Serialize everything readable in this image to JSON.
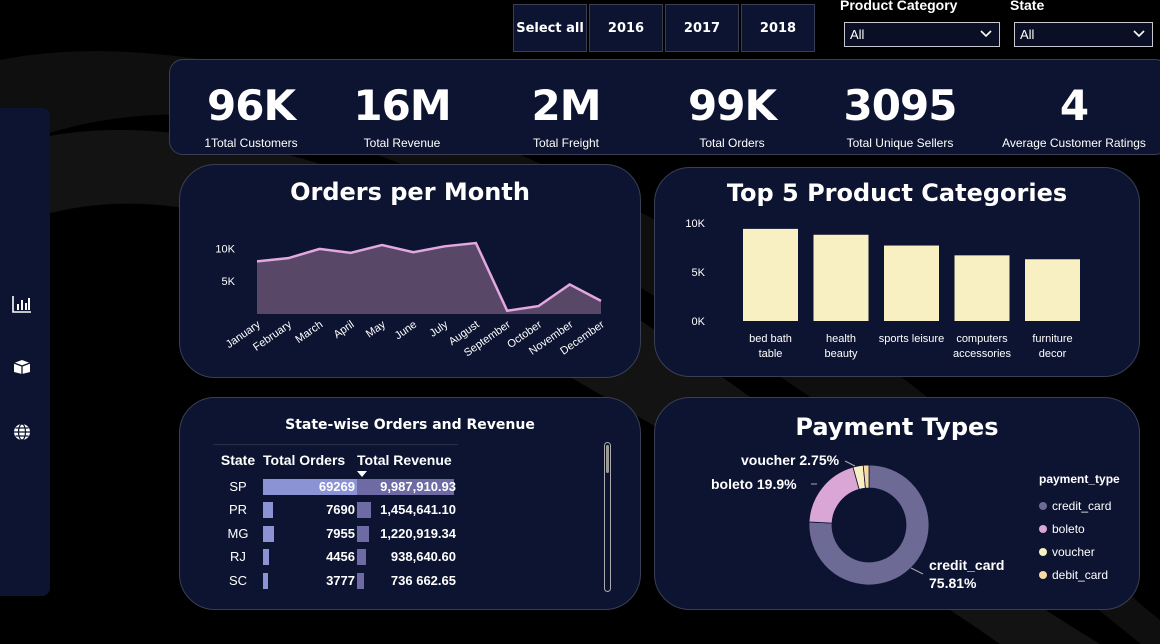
{
  "colors": {
    "background": "#000000",
    "panel": "#0d1431",
    "area_fill": "#594768",
    "area_line": "#e3a8e0",
    "bar_yellow": "#f8efc2",
    "table_bar_orders": "#8b93d4",
    "table_bar_revenue": "#6e6aa3",
    "donut_credit": "#6e6a96",
    "donut_boleto": "#d9a6d6",
    "donut_voucher": "#f8efc2",
    "donut_debit": "#f9d8a8"
  },
  "sidebar": {
    "icons": [
      "bar-chart-icon",
      "box-icon",
      "globe-icon"
    ]
  },
  "year_slicer": {
    "options": [
      "Select all",
      "2016",
      "2017",
      "2018"
    ]
  },
  "filters": {
    "category": {
      "label": "Product Category",
      "value": "All"
    },
    "state": {
      "label": "State",
      "value": "All"
    }
  },
  "kpis": [
    {
      "value": "96K",
      "label": "1Total Customers"
    },
    {
      "value": "16M",
      "label": "Total Revenue"
    },
    {
      "value": "2M",
      "label": "Total Freight"
    },
    {
      "value": "99K",
      "label": "Total Orders"
    },
    {
      "value": "3095",
      "label": "Total Unique Sellers"
    },
    {
      "value": "4",
      "label": "Average Customer Ratings"
    }
  ],
  "chart_data": [
    {
      "id": "orders_per_month",
      "type": "area",
      "title": "Orders per Month",
      "categories": [
        "January",
        "February",
        "March",
        "April",
        "May",
        "June",
        "July",
        "August",
        "September",
        "October",
        "November",
        "December"
      ],
      "values": [
        8000,
        8500,
        9900,
        9300,
        10500,
        9400,
        10300,
        10800,
        500,
        1200,
        4500,
        2000
      ],
      "ylim": [
        0,
        14000
      ],
      "yticks": [
        5000,
        10000
      ],
      "ytick_labels": [
        "5K",
        "10K"
      ],
      "grid": false
    },
    {
      "id": "top5_categories",
      "type": "bar",
      "title": "Top 5 Product Categories",
      "categories": [
        [
          "bed bath",
          "table"
        ],
        [
          "health",
          "beauty"
        ],
        [
          "sports leisure"
        ],
        [
          "computers",
          "accessories"
        ],
        [
          "furniture",
          "decor"
        ]
      ],
      "values": [
        9400,
        8800,
        7700,
        6700,
        6300
      ],
      "ylim": [
        0,
        10000
      ],
      "yticks": [
        0,
        5000,
        10000
      ],
      "ytick_labels": [
        "0K",
        "5K",
        "10K"
      ],
      "grid": false
    },
    {
      "id": "payment_types",
      "type": "pie",
      "title": "Payment Types",
      "legend_title": "payment_type",
      "legend_position": "right",
      "slices": [
        {
          "name": "credit_card",
          "value": 75.81
        },
        {
          "name": "boleto",
          "value": 19.9
        },
        {
          "name": "voucher",
          "value": 2.75
        },
        {
          "name": "debit_card",
          "value": 1.54
        }
      ],
      "labels": {
        "credit_card": [
          "credit_card",
          "75.81%"
        ],
        "boleto": "boleto 19.9%",
        "voucher": "voucher 2.75%"
      }
    },
    {
      "id": "state_table",
      "type": "table",
      "title": "State-wise Orders and Revenue",
      "columns": [
        "State",
        "Total Orders",
        "Total Revenue"
      ],
      "rows": [
        {
          "state": "SP",
          "orders": 69269,
          "orders_text": "69269",
          "revenue": 9987910.93,
          "revenue_text": "9,987,910.93"
        },
        {
          "state": "PR",
          "orders": 7690,
          "orders_text": "7690",
          "revenue": 1454641.1,
          "revenue_text": "1,454,641.10"
        },
        {
          "state": "MG",
          "orders": 7955,
          "orders_text": "7955",
          "revenue": 1220919.34,
          "revenue_text": "1,220,919.34"
        },
        {
          "state": "RJ",
          "orders": 4456,
          "orders_text": "4456",
          "revenue": 938640.6,
          "revenue_text": "938,640.60"
        },
        {
          "state": "SC",
          "orders": 3777,
          "orders_text": "3777",
          "revenue": 736662.65,
          "revenue_text": "736 662.65"
        }
      ]
    }
  ]
}
